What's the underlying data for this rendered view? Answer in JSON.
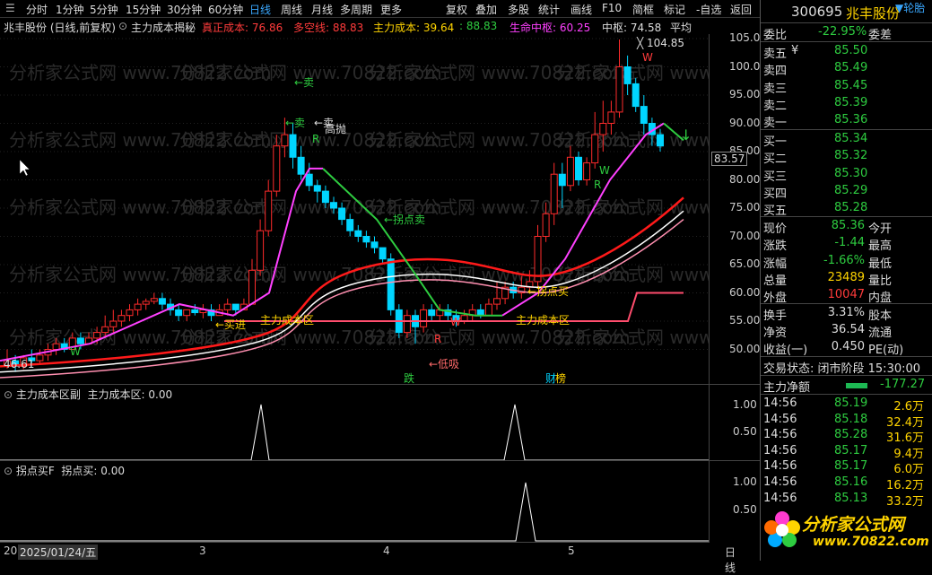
{
  "toolbar": {
    "items": [
      "分时",
      "1分钟",
      "5分钟",
      "15分钟",
      "30分钟",
      "60分钟",
      "日线",
      "周线",
      "月线",
      "多周期",
      "更多",
      "复权",
      "叠加",
      "多股",
      "统计",
      "画线",
      "F10",
      "简框",
      "标记",
      "-自选",
      "返回"
    ],
    "active_index": 6
  },
  "info_line": {
    "stock": "兆丰股份 (日线,前复权)",
    "indicator": "主力成本揭秘",
    "items": [
      {
        "label": "真正成本: 76.86",
        "color": "#ff3b3b"
      },
      {
        "label": "多空线: 88.83",
        "color": "#ff3b3b"
      },
      {
        "label": "主力成本: 39.64",
        "color": "#ffd400"
      },
      {
        "label": ": 88.83",
        "color": "#2ecc40"
      },
      {
        "label": "生命中枢: 60.25",
        "color": "#ff40ff"
      },
      {
        "label": "中枢: 74.58",
        "color": "#ddd"
      },
      {
        "label": "平均",
        "color": "#ddd"
      }
    ]
  },
  "price_axis": {
    "labels": [
      "105.0",
      "100.0",
      "95.00",
      "90.00",
      "85.00",
      "80.00",
      "75.00",
      "70.00",
      "65.00",
      "60.00",
      "55.00",
      "50.00"
    ],
    "current": "83.57"
  },
  "chart_annotations": {
    "high": "104.85",
    "low": "46.61",
    "sell": "←卖",
    "sell2": "←卖",
    "high_throw": "高抛",
    "buy_in": "←买进",
    "main_cost_zone_1": "主力成本区",
    "main_cost_zone_2": "主力成本区",
    "inflection_sell": "←拐点卖",
    "inflection_buy": "←拐点买",
    "low_absorb": "←低吸",
    "drop": "跌",
    "caibang": "财",
    "caibang2": "榜",
    "sell_top": "←卖",
    "w1": "W",
    "r1": "R",
    "w2": "W",
    "r2": "R",
    "w3": "W",
    "r3": "R",
    "w4": "W",
    "r4": "R"
  },
  "sub_panel_1": {
    "title": "主力成本区副",
    "value": "主力成本区: 0.00",
    "axis": [
      "1.00",
      "0.50"
    ]
  },
  "sub_panel_2": {
    "title": "拐点买F",
    "value": "拐点买: 0.00",
    "axis": [
      "1.00",
      "0.50"
    ]
  },
  "date_bar": {
    "start": "20",
    "date": "2025/01/24/五",
    "ticks": [
      "3",
      "4",
      "5"
    ],
    "period": "日线"
  },
  "watermark": "分析家公式网 www.70822.com",
  "right_panel": {
    "code": "300695",
    "name": "兆丰股份",
    "corner": "▼轮胎",
    "ratio_label": "委比",
    "ratio_value": "-22.95%",
    "diff_label": "委差",
    "sell": [
      {
        "label": "卖五",
        "price": "85.50"
      },
      {
        "label": "卖四",
        "price": "85.49"
      },
      {
        "label": "卖三",
        "price": "85.45"
      },
      {
        "label": "卖二",
        "price": "85.39"
      },
      {
        "label": "卖一",
        "price": "85.36"
      }
    ],
    "yen": "¥",
    "buy": [
      {
        "label": "买一",
        "price": "85.34"
      },
      {
        "label": "买二",
        "price": "85.32"
      },
      {
        "label": "买三",
        "price": "85.30"
      },
      {
        "label": "买四",
        "price": "85.29"
      },
      {
        "label": "买五",
        "price": "85.28"
      }
    ],
    "stats": [
      {
        "l": "现价",
        "v": "85.36",
        "vc": "green",
        "r": "今开"
      },
      {
        "l": "涨跌",
        "v": "-1.44",
        "vc": "green",
        "r": "最高"
      },
      {
        "l": "涨幅",
        "v": "-1.66%",
        "vc": "green",
        "r": "最低"
      },
      {
        "l": "总量",
        "v": "23489",
        "vc": "yellow",
        "r": "量比"
      },
      {
        "l": "外盘",
        "v": "10047",
        "vc": "red",
        "r": "内盘"
      }
    ],
    "stats2": [
      {
        "l": "换手",
        "v": "3.31%",
        "vc": "white",
        "r": "股本"
      },
      {
        "l": "净资",
        "v": "36.54",
        "vc": "white",
        "r": "流通"
      },
      {
        "l": "收益(一)",
        "v": "0.450",
        "vc": "white",
        "r": "PE(动)"
      }
    ],
    "trade_state": "交易状态: 闭市阶段 15:30:00",
    "net_label": "主力净额",
    "net_value": "-177.27",
    "ticks": [
      {
        "t": "14:56",
        "p": "85.19",
        "v": "2.6万"
      },
      {
        "t": "14:56",
        "p": "85.18",
        "v": "32.4万"
      },
      {
        "t": "14:56",
        "p": "85.28",
        "v": "31.6万"
      },
      {
        "t": "14:56",
        "p": "85.17",
        "v": "9.4万"
      },
      {
        "t": "14:56",
        "p": "85.17",
        "v": "6.0万"
      },
      {
        "t": "14:56",
        "p": "85.16",
        "v": "16.2万"
      },
      {
        "t": "14:56",
        "p": "85.13",
        "v": "33.2万"
      }
    ],
    "logo_text": "分析家公式网",
    "logo_url": "www.70822.com"
  }
}
